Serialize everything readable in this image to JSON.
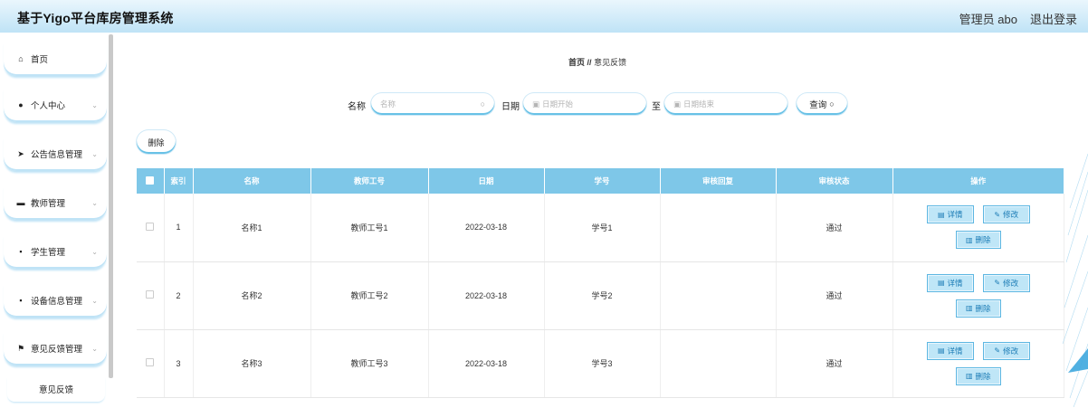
{
  "header": {
    "title": "基于Yigo平台库房管理系统",
    "user": "管理员 abo",
    "logout": "退出登录"
  },
  "sidebar": {
    "items": [
      {
        "label": "首页",
        "icon": "home-icon",
        "glyph": "⌂"
      },
      {
        "label": "个人中心",
        "icon": "user-icon",
        "glyph": "●"
      },
      {
        "label": "公告信息管理",
        "icon": "send-icon",
        "glyph": "➤"
      },
      {
        "label": "教师管理",
        "icon": "card-icon",
        "glyph": "▬"
      },
      {
        "label": "学生管理",
        "icon": "grid-icon",
        "glyph": "▪"
      },
      {
        "label": "设备信息管理",
        "icon": "grid-icon",
        "glyph": "▪"
      },
      {
        "label": "意见反馈管理",
        "icon": "flag-icon",
        "glyph": "⚑"
      }
    ],
    "sub_item": "意见反馈",
    "chevron": "⌄"
  },
  "breadcrumb": {
    "home": "首页",
    "sep": "//",
    "current": "意见反馈"
  },
  "search": {
    "name_label": "名称",
    "name_placeholder": "名称",
    "date_label": "日期",
    "date_start_placeholder": "日期开始",
    "to_label": "至",
    "date_end_placeholder": "日期结束",
    "query_button": "查询"
  },
  "toolbar": {
    "delete_label": "删除"
  },
  "table": {
    "columns": [
      "索引",
      "名称",
      "教师工号",
      "日期",
      "学号",
      "审核回复",
      "审核状态",
      "操作"
    ],
    "rows": [
      {
        "index": "1",
        "name": "名称1",
        "teacher_id": "教师工号1",
        "date": "2022-03-18",
        "student_id": "学号1",
        "reply": "",
        "status": "通过"
      },
      {
        "index": "2",
        "name": "名称2",
        "teacher_id": "教师工号2",
        "date": "2022-03-18",
        "student_id": "学号2",
        "reply": "",
        "status": "通过"
      },
      {
        "index": "3",
        "name": "名称3",
        "teacher_id": "教师工号3",
        "date": "2022-03-18",
        "student_id": "学号3",
        "reply": "",
        "status": "通过"
      }
    ],
    "actions": {
      "detail": "详情",
      "edit": "修改",
      "delete": "删除"
    }
  },
  "colors": {
    "header_bg": "#bfe3f6",
    "table_header": "#7ec7e8",
    "accent": "#68c1e6",
    "action_bg": "#bfe6f7"
  }
}
